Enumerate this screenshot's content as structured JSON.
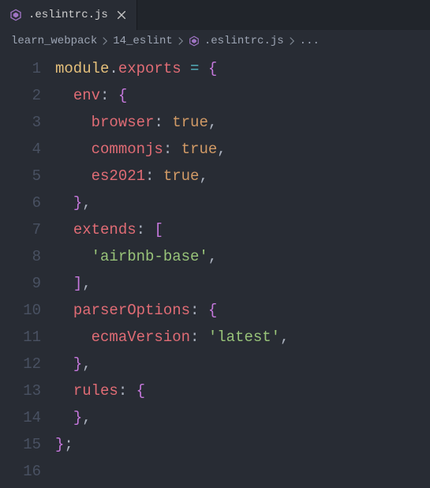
{
  "tab": {
    "label": ".eslintrc.js"
  },
  "breadcrumbs": {
    "part1": "learn_webpack",
    "part2": "14_eslint",
    "file": ".eslintrc.js",
    "tail": "..."
  },
  "lineNumbers": [
    "1",
    "2",
    "3",
    "4",
    "5",
    "6",
    "7",
    "8",
    "9",
    "10",
    "11",
    "12",
    "13",
    "14",
    "15",
    "16"
  ],
  "code": {
    "kw_module": "module",
    "dot": ".",
    "kw_exports": "exports",
    "op_eq": " = ",
    "lbrace": "{",
    "rbrace": "}",
    "lbracket": "[",
    "rbracket": "]",
    "comma": ",",
    "colon": ": ",
    "semi": ";",
    "key_env": "env",
    "key_browser": "browser",
    "key_commonjs": "commonjs",
    "key_es2021": "es2021",
    "key_extends": "extends",
    "key_parserOptions": "parserOptions",
    "key_ecmaVersion": "ecmaVersion",
    "key_rules": "rules",
    "val_true": "true",
    "str_airbnb": "'airbnb-base'",
    "str_latest": "'latest'",
    "indent1": "  ",
    "indent2": "    ",
    "sp": " "
  },
  "colors": {
    "accent_hex": "#a074c4"
  }
}
